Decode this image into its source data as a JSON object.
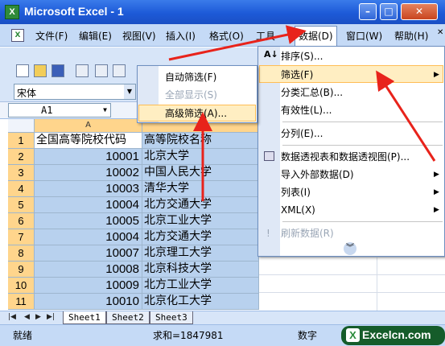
{
  "window": {
    "title": "Microsoft Excel - 1",
    "app_icon_letter": "X",
    "minimize": "–",
    "maximize": "□",
    "close": "✕"
  },
  "menubar": {
    "items": [
      "文件(F)",
      "编辑(E)",
      "视图(V)",
      "插入(I)",
      "格式(O)",
      "工具",
      "数据(D)",
      "窗口(W)",
      "帮助(H)"
    ],
    "doc_close": "✕"
  },
  "toolbar": {
    "font_name": "宋体"
  },
  "formula": {
    "name_box": "A1"
  },
  "grid": {
    "columns": [
      "A",
      "B"
    ],
    "rows": [
      {
        "num": "1",
        "a": "全国高等院校代码",
        "b": "高等院校名称"
      },
      {
        "num": "2",
        "a": "10001",
        "b": "北京大学"
      },
      {
        "num": "3",
        "a": "10002",
        "b": "中国人民大学"
      },
      {
        "num": "4",
        "a": "10003",
        "b": "清华大学"
      },
      {
        "num": "5",
        "a": "10004",
        "b": "北方交通大学"
      },
      {
        "num": "6",
        "a": "10005",
        "b": "北京工业大学"
      },
      {
        "num": "7",
        "a": "10004",
        "b": "北方交通大学"
      },
      {
        "num": "8",
        "a": "10007",
        "b": "北京理工大学"
      },
      {
        "num": "9",
        "a": "10008",
        "b": "北京科技大学"
      },
      {
        "num": "10",
        "a": "10009",
        "b": "北方工业大学"
      },
      {
        "num": "11",
        "a": "10010",
        "b": "北京化工大学"
      }
    ]
  },
  "sheets": [
    "Sheet1",
    "Sheet2",
    "Sheet3"
  ],
  "status": {
    "ready": "就绪",
    "sum": "求和=1847981",
    "mode": "数字"
  },
  "logo": {
    "text": "Excelcn.com",
    "mark": "X"
  },
  "data_menu": {
    "items": [
      {
        "label": "排序(S)..."
      },
      {
        "label": "筛选(F)",
        "submenu": true
      },
      {
        "label": "分类汇总(B)..."
      },
      {
        "label": "有效性(L)..."
      },
      {
        "label": "分列(E)..."
      },
      {
        "label": "数据透视表和数据透视图(P)..."
      },
      {
        "label": "导入外部数据(D)",
        "submenu": true
      },
      {
        "label": "列表(I)",
        "submenu": true
      },
      {
        "label": "XML(X)",
        "submenu": true
      },
      {
        "label": "刷新数据(R)",
        "disabled": true
      }
    ],
    "more": "︾"
  },
  "filter_submenu": {
    "items": [
      {
        "label": "自动筛选(F)"
      },
      {
        "label": "全部显示(S)",
        "disabled": true
      },
      {
        "label": "高级筛选(A)..."
      }
    ]
  },
  "colors": {
    "title_bar": "#1d5ad8",
    "selection": "#b8d1ee",
    "highlight": "#ffeec2",
    "arrow": "#e8231b"
  }
}
